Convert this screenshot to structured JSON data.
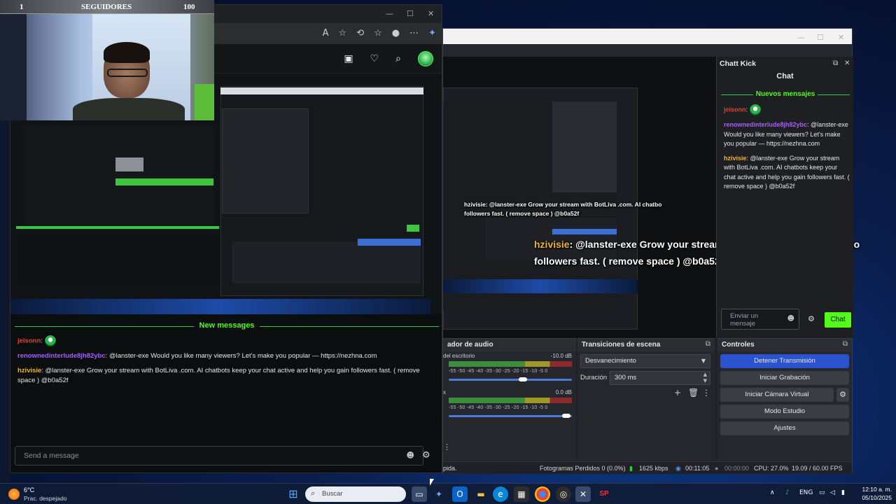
{
  "webcam": {
    "follow_left": "1",
    "follow_title": "SEGUIDORES",
    "follow_right": "100"
  },
  "browser": {
    "new_messages_label": "New messages",
    "messages": [
      {
        "user": "jeisonn",
        "text": ""
      },
      {
        "user": "renownedinterlude8jh82ybc",
        "text": "@lanster-exe Would you like many viewers? Let's make you popular — https://nezhna.com"
      },
      {
        "user": "hzivisie",
        "text": "@lanster-exe Grow your stream with BotLiva .com. AI chatbots keep your chat active and help you gain followers fast. ( remove space ) @b0a52f"
      }
    ],
    "send_placeholder": "Send a message"
  },
  "obs": {
    "overlay_user": "hzivisie",
    "overlay_line1": ": @lanster-exe Grow your stream with BotLiva .com. AI chatbo",
    "overlay_line2": "followers fast. ( remove space ) @b0a52f",
    "mini_overlay_line1": "hzivisie: @lanster-exe Grow your stream with BotLiva .com. AI chatbo",
    "mini_overlay_line2": "followers fast. ( remove space ) @b0a52f",
    "dock": {
      "title": "Chatt Kick",
      "subtitle": "Chat",
      "new_messages_label": "Nuevos mensajes",
      "messages": [
        {
          "user": "jeisonn",
          "text": ""
        },
        {
          "user": "renownedinterlude8jh82ybc",
          "text": "@lanster-exe Would you like many viewers? Let's make you popular — https://nezhna.com"
        },
        {
          "user": "hzivisie",
          "text": "@lanster-exe Grow your stream with BotLiva .com. AI chatbots keep your chat active and help you gain followers fast. ( remove space ) @b0a52f"
        }
      ],
      "input_placeholder": "Enviar un mensaje",
      "chat_button": "Chat"
    },
    "mixer": {
      "title": "ador de audio",
      "tracks": [
        {
          "name": "del escritorio",
          "db": "-10.0 dB"
        },
        {
          "name": "x",
          "db": "0.0 dB"
        }
      ],
      "scale": "-55  -50  -45  -40  -35  -30  -25  -20  -15  -10  -5  0"
    },
    "transitions": {
      "title": "Transiciones de escena",
      "selected": "Desvanecimiento",
      "duration_label": "Duración",
      "duration_value": "300 ms"
    },
    "controls": {
      "title": "Controles",
      "stop_stream": "Detener Transmisión",
      "start_recording": "Iniciar Grabación",
      "start_virtual_cam": "Iniciar Cámara Virtual",
      "studio_mode": "Modo Estudio",
      "settings": "Ajustes"
    },
    "status": {
      "left_text": "pida.",
      "dropped_frames": "Fotogramas Perdidos 0 (0.0%)",
      "bitrate": "1625 kbps",
      "stream_time": "00:11:05",
      "rec_time": "00:00:00",
      "cpu": "CPU: 27.0%",
      "fps": "19.09 / 60.00 FPS"
    }
  },
  "taskbar": {
    "temperature": "6°C",
    "weather": "Prac. despejado",
    "search_placeholder": "Buscar",
    "language": "ENG",
    "time": "12:10 a. m.",
    "date": "05/10/2025"
  },
  "colors": {
    "kick_green": "#53fc18",
    "obs_blue": "#2c53cf",
    "user_red": "#e0452b",
    "user_purple": "#a95cff",
    "user_gold": "#f0b429"
  }
}
